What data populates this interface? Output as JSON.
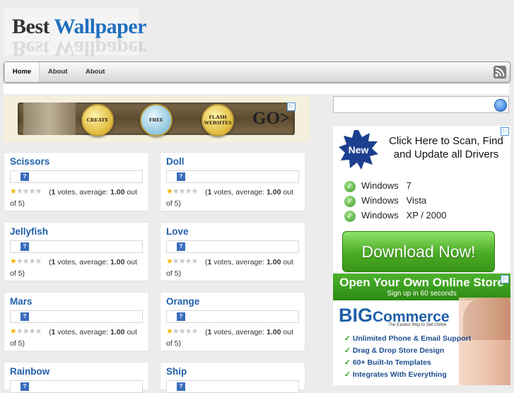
{
  "site": {
    "logo_word1": "Best",
    "logo_word2": "Wallpaper"
  },
  "nav": [
    {
      "label": "Home"
    },
    {
      "label": "About"
    },
    {
      "label": "About"
    }
  ],
  "banner": {
    "badge1": "CREATE",
    "badge2": "FREE",
    "badge3": "FLASH WEBSITES",
    "go": "GO>"
  },
  "search": {
    "placeholder": ""
  },
  "cards": [
    {
      "title": "Scissors",
      "votes": "1",
      "average": "1.00"
    },
    {
      "title": "Doll",
      "votes": "1",
      "average": "1.00"
    },
    {
      "title": "Jellyfish",
      "votes": "1",
      "average": "1.00"
    },
    {
      "title": "Love",
      "votes": "1",
      "average": "1.00"
    },
    {
      "title": "Mars",
      "votes": "1",
      "average": "1.00"
    },
    {
      "title": "Orange",
      "votes": "1",
      "average": "1.00"
    },
    {
      "title": "Rainbow"
    },
    {
      "title": "Ship"
    }
  ],
  "rating_text": {
    "prefix": "(",
    "votes_word": " votes, average: ",
    "suffix": " out of 5)"
  },
  "ad1": {
    "badge": "New",
    "headline": "Click Here to Scan, Find and Update all Drivers",
    "rows": [
      "Windows   7",
      "Windows   Vista",
      "Windows   XP / 2000"
    ],
    "button": "Download Now!"
  },
  "ad2": {
    "headline": "Open Your Own Online Store",
    "subline": "Sign up in 60 seconds",
    "brand_big": "BIG",
    "brand_rest": "Commerce",
    "tagline": "The Easiest Way to Sell Online",
    "bullets": [
      "Unlimited Phone & Email Support",
      "Drag & Drop Store Design",
      "60+ Built-In Templates",
      "Integrates With Everything"
    ]
  },
  "colors": {
    "link": "#1f5fa8",
    "star_on": "#f0b400",
    "ad_green": "#4aab24"
  }
}
